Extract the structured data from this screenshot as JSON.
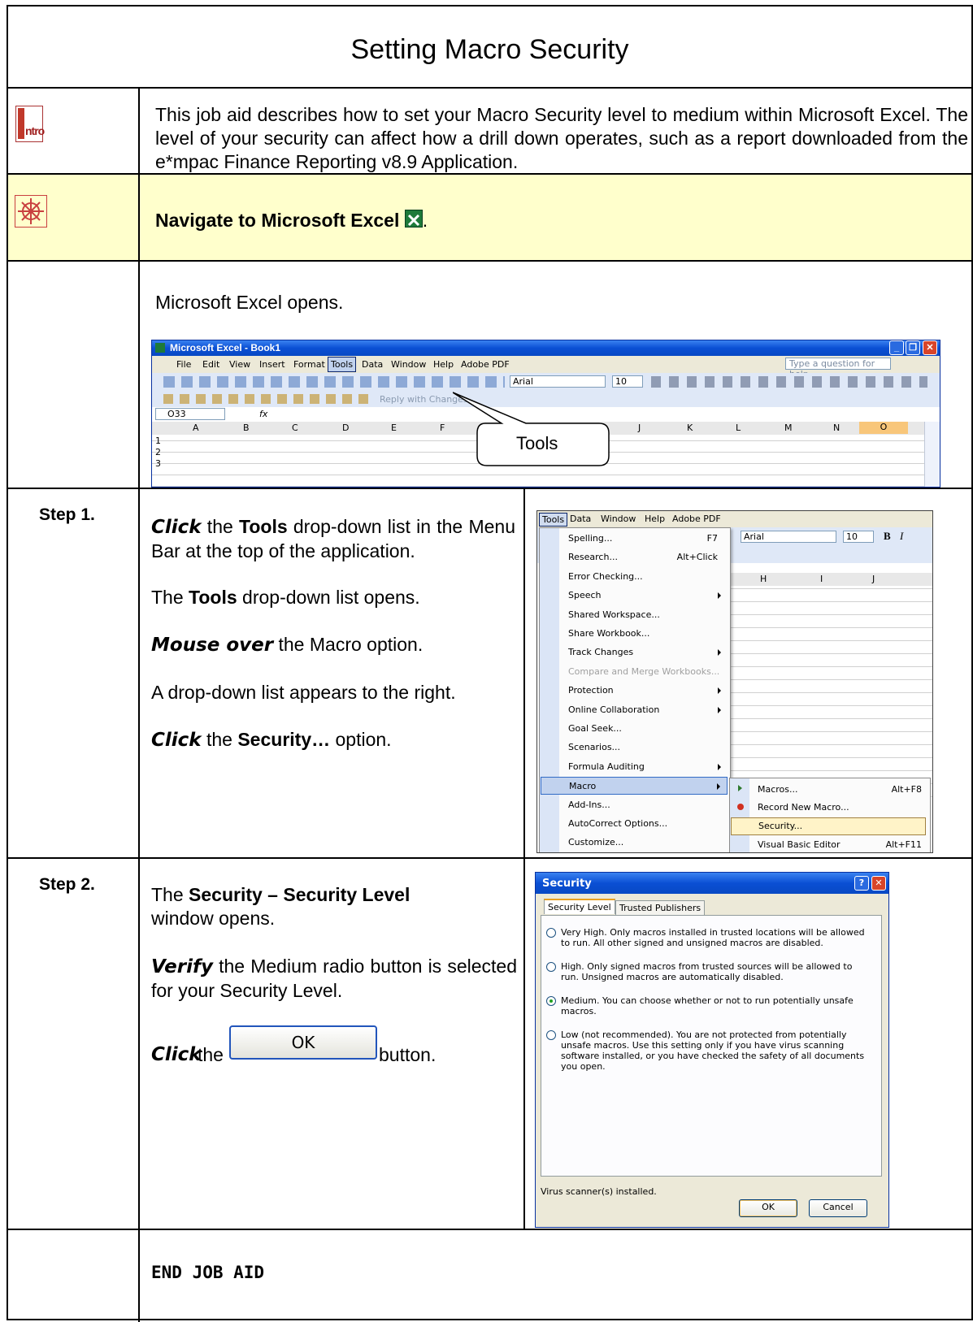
{
  "title": "Setting Macro Security",
  "intro": {
    "icon_label": "ntro",
    "text": "This job aid describes how to set your Macro Security level to medium within Microsoft Excel.  The level of your security can affect how a drill down operates, such as a report downloaded from the e*mpac Finance Reporting v8.9 Application."
  },
  "navigate": {
    "text": "Navigate to Microsoft Excel",
    "period": "."
  },
  "opens": {
    "text": "Microsoft Excel opens.",
    "excel": {
      "window_title": "Microsoft Excel - Book1",
      "menus": [
        "File",
        "Edit",
        "View",
        "Insert",
        "Format",
        "Tools",
        "Data",
        "Window",
        "Help",
        "Adobe PDF"
      ],
      "help_placeholder": "Type a question for help",
      "font": "Arial",
      "size": "10",
      "reply_text": "Reply with Changes...",
      "cell_ref": "O33",
      "fx": "fx",
      "columns": [
        "A",
        "B",
        "C",
        "D",
        "E",
        "F",
        "J",
        "K",
        "L",
        "M",
        "N",
        "O"
      ],
      "rows": [
        "1",
        "2",
        "3"
      ],
      "callout": "Tools"
    }
  },
  "step1": {
    "label": "Step 1.",
    "lines": [
      {
        "b": "Click",
        "t": " the ",
        "b2": "Tools",
        "t2": " drop-down list in the Menu Bar at the top of the application."
      },
      {
        "t": "The ",
        "b2": "Tools",
        "t2": " drop-down list opens."
      },
      {
        "b": "Mouse over",
        "t": " the Macro option."
      },
      {
        "t": "A drop-down list appears to the right."
      },
      {
        "b": "Click",
        "t": " the ",
        "b2": "Security…",
        "t2": " option."
      }
    ],
    "menu_bar": [
      "Tools",
      "Data",
      "Window",
      "Help",
      "Adobe PDF"
    ],
    "toolbar_font": "Arial",
    "toolbar_size": "10",
    "menu_items": [
      {
        "label": "Spelling...",
        "shortcut": "F7"
      },
      {
        "label": "Research...",
        "shortcut": "Alt+Click"
      },
      {
        "label": "Error Checking...",
        "shortcut": ""
      },
      {
        "label": "Speech",
        "shortcut": "",
        "sub": true
      },
      {
        "label": "Shared Workspace...",
        "shortcut": ""
      },
      {
        "label": "Share Workbook...",
        "shortcut": ""
      },
      {
        "label": "Track Changes",
        "shortcut": "",
        "sub": true
      },
      {
        "label": "Compare and Merge Workbooks...",
        "shortcut": "",
        "disabled": true
      },
      {
        "label": "Protection",
        "shortcut": "",
        "sub": true
      },
      {
        "label": "Online Collaboration",
        "shortcut": "",
        "sub": true
      },
      {
        "label": "Goal Seek...",
        "shortcut": ""
      },
      {
        "label": "Scenarios...",
        "shortcut": ""
      },
      {
        "label": "Formula Auditing",
        "shortcut": "",
        "sub": true
      },
      {
        "label": "Macro",
        "shortcut": "",
        "sub": true,
        "highlight": true
      },
      {
        "label": "Add-Ins...",
        "shortcut": ""
      },
      {
        "label": "AutoCorrect Options...",
        "shortcut": ""
      },
      {
        "label": "Customize...",
        "shortcut": ""
      }
    ],
    "sheet_columns": [
      "H",
      "I",
      "J"
    ],
    "submenu": [
      {
        "label": "Macros...",
        "shortcut": "Alt+F8"
      },
      {
        "label": "Record New Macro...",
        "shortcut": ""
      },
      {
        "label": "Security...",
        "shortcut": ""
      },
      {
        "label": "Visual Basic Editor",
        "shortcut": "Alt+F11"
      }
    ]
  },
  "step2": {
    "label": "Step 2.",
    "line1_b": "The ",
    "line1_bold": "Security – Security Level",
    "line1_rest": "window opens.",
    "verify_b": "Verify",
    "verify_t": " the Medium radio button is selected for your Security Level.",
    "click_b": "Click",
    "click_the": " the ",
    "ok_label": "OK",
    "button_text": " button.",
    "dialog": {
      "title": "Security",
      "tabs": [
        "Security Level",
        "Trusted Publishers"
      ],
      "options": [
        {
          "label": "Very High. Only macros installed in trusted locations will be allowed to run. All other signed and unsigned macros are disabled.",
          "selected": false
        },
        {
          "label": "High. Only signed macros from trusted sources will be allowed to run. Unsigned macros are automatically disabled.",
          "selected": false
        },
        {
          "label": "Medium. You can choose whether or not to run potentially unsafe macros.",
          "selected": true
        },
        {
          "label": "Low (not recommended). You are not protected from potentially unsafe macros. Use this setting only if you have virus scanning software installed, or you have checked the safety of all documents you open.",
          "selected": false
        }
      ],
      "status": "Virus scanner(s) installed.",
      "ok": "OK",
      "cancel": "Cancel"
    }
  },
  "end": "END JOB AID"
}
